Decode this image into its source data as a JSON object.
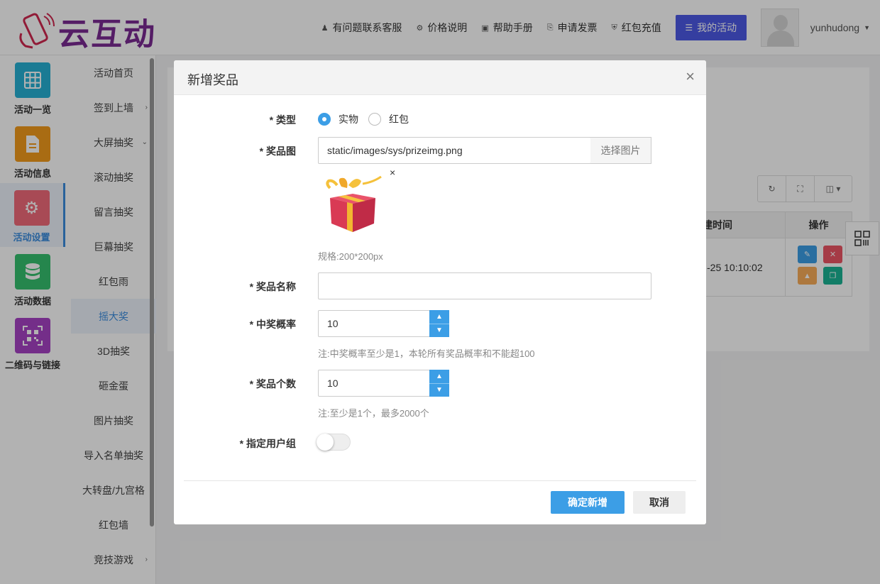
{
  "header": {
    "brand": "云互动",
    "nav": [
      {
        "label": "有问题联系客服",
        "icon": "user-plus-icon"
      },
      {
        "label": "价格说明",
        "icon": "gear-icon"
      },
      {
        "label": "帮助手册",
        "icon": "book-icon"
      },
      {
        "label": "申请发票",
        "icon": "printer-icon"
      },
      {
        "label": "红包充值",
        "icon": "shield-icon"
      }
    ],
    "my_activity": "我的活动",
    "username": "yunhudong"
  },
  "iconbar": [
    {
      "label": "活动一览",
      "color": "#26b1d5"
    },
    {
      "label": "活动信息",
      "color": "#f39b1c"
    },
    {
      "label": "活动设置",
      "color": "#f16b7a"
    },
    {
      "label": "活动数据",
      "color": "#36c16f"
    },
    {
      "label": "二维码与链接",
      "color": "#a642c4"
    }
  ],
  "subbar": [
    {
      "label": "活动首页"
    },
    {
      "label": "签到上墙",
      "arrow": "›"
    },
    {
      "label": "大屏抽奖",
      "arrow": "⌄"
    },
    {
      "label": "滚动抽奖"
    },
    {
      "label": "留言抽奖"
    },
    {
      "label": "巨幕抽奖"
    },
    {
      "label": "红包雨"
    },
    {
      "label": "摇大奖"
    },
    {
      "label": "3D抽奖"
    },
    {
      "label": "砸金蛋"
    },
    {
      "label": "图片抽奖"
    },
    {
      "label": "导入名单抽奖"
    },
    {
      "label": "大转盘/九宫格"
    },
    {
      "label": "红包墙"
    },
    {
      "label": "竞技游戏",
      "arrow": "›"
    }
  ],
  "table": {
    "col_time": "建时间",
    "col_ops": "操作",
    "row_time": "-25 10:10:02"
  },
  "modal": {
    "title": "新增奖品",
    "close": "×",
    "type_label": "* 类型",
    "type_options": [
      "实物",
      "红包"
    ],
    "type_selected": "实物",
    "image_label": "* 奖品图",
    "image_value": "static/images/sys/prizeimg.png",
    "image_button": "选择图片",
    "image_remove": "×",
    "image_hint": "规格:200*200px",
    "name_label": "* 奖品名称",
    "name_value": "",
    "prob_label": "* 中奖概率",
    "prob_value": "10",
    "prob_hint": "注:中奖概率至少是1，本轮所有奖品概率和不能超100",
    "count_label": "* 奖品个数",
    "count_value": "10",
    "count_hint": "注:至少是1个，最多2000个",
    "group_label": "* 指定用户组",
    "group_enabled": false,
    "ok": "确定新增",
    "cancel": "取消"
  },
  "colors": {
    "primary": "#3c9ee6",
    "my_activity_bg": "#4d5ae6"
  }
}
